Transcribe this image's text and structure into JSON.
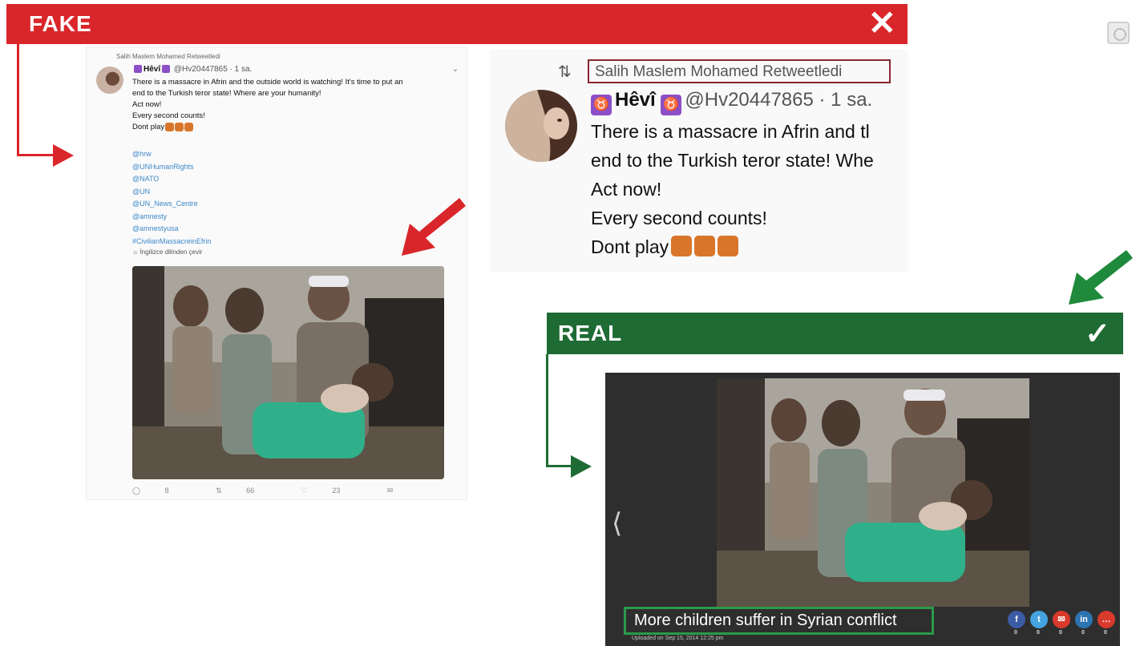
{
  "fake": {
    "label": "FAKE",
    "close_glyph": "✕",
    "color": "#d9262a"
  },
  "real": {
    "label": "REAL",
    "check_glyph": "✓",
    "color": "#1f6b34"
  },
  "tweet": {
    "retweeted_by": "Salih Maslem Mohamed Retweetledi",
    "display_name": "Hêvî",
    "handle": "@Hv20447865 · 1 sa.",
    "lines": [
      "There is a massacre in Afrin and the outside world is watching! It's time to put an",
      "end to the Turkish teror state! Where are your humanity!",
      "Act now!",
      "Every second counts!",
      "Dont play"
    ],
    "mentions": [
      "@hrw",
      "@UNHumanRights",
      "@NATO",
      "@UN",
      "@UN_News_Centre",
      "@amnesty",
      "@amnestyusa",
      "#CivilianMassacreinEfrin"
    ],
    "translate": "İngilizce dilinden çevir",
    "actions": {
      "reply": "8",
      "retweet": "66",
      "like": "23"
    }
  },
  "zoom": {
    "retweeted_by": "Salih Maslem Mohamed Retweetledi",
    "display_name": "Hêvî",
    "handle": "@Hv20447865 · 1 sa.",
    "lines": [
      "There is a massacre in Afrin and tl",
      "end to the Turkish teror state! Whe",
      "Act now!",
      "Every second counts!",
      "Dont play"
    ]
  },
  "news": {
    "caption": "More children suffer in Syrian conflict",
    "uploaded": "Uploaded on Sep 15, 2014 12:25 pm",
    "share": [
      {
        "name": "facebook",
        "glyph": "f",
        "color": "#3b5ba4",
        "count": "0"
      },
      {
        "name": "twitter",
        "glyph": "t",
        "color": "#44a3e0",
        "count": "0"
      },
      {
        "name": "email",
        "glyph": "✉",
        "color": "#d93a2c",
        "count": "0"
      },
      {
        "name": "linkedin",
        "glyph": "in",
        "color": "#2d74b2",
        "count": "0"
      },
      {
        "name": "comment",
        "glyph": "…",
        "color": "#d93a2c",
        "count": "0"
      }
    ]
  }
}
